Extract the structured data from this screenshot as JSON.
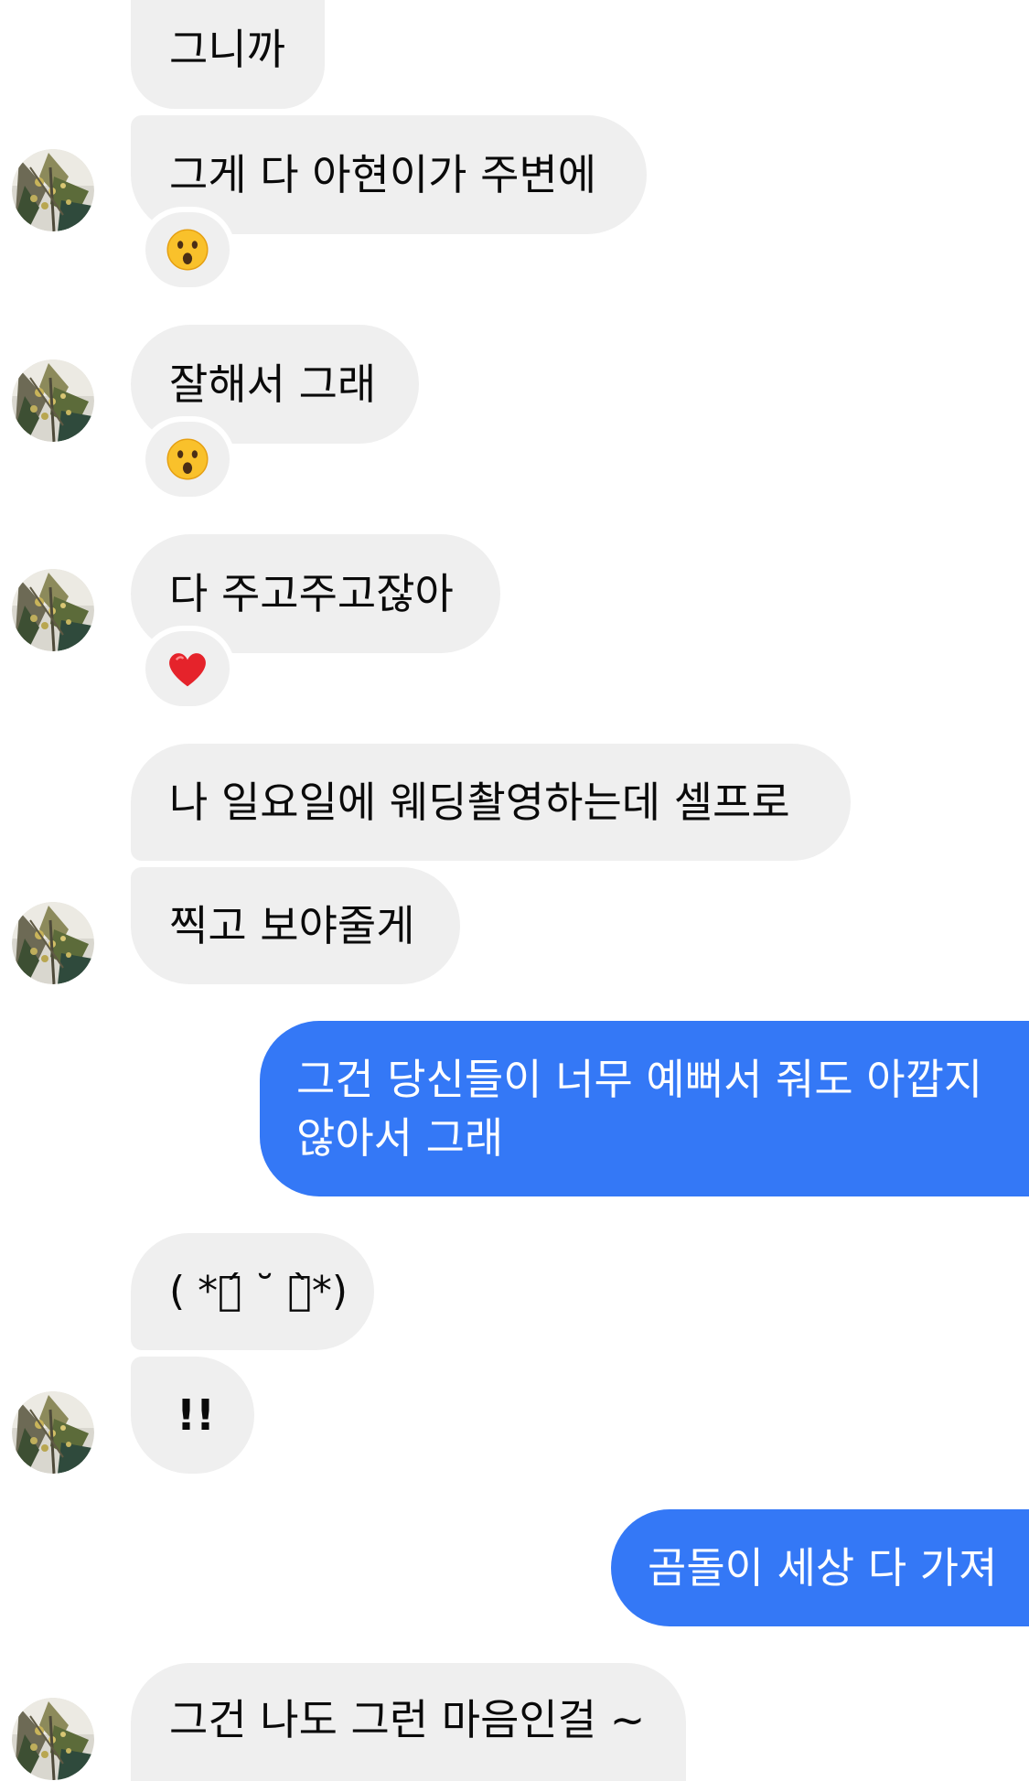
{
  "messages": {
    "m1": "그니까",
    "m2": "그게 다 아현이가 주변에",
    "m3": "잘해서 그래",
    "m4": "다 주고주고잖아",
    "m5": "나 일요일에 웨딩촬영하는데 셀프로",
    "m6": "찍고 보야줄게",
    "m7": "그건 당신들이 너무 예뻐서 줘도 아깝지 않아서 그래",
    "m8": "( *ก́ ˘ ก̀*)",
    "m9": "!!",
    "m10": "곰돌이 세상 다 가져",
    "m11": "그건 나도 그런 마음인걸 ~"
  },
  "reactions": {
    "r1": "astonished-face",
    "r2": "astonished-face",
    "r3": "red-heart"
  },
  "colors": {
    "incoming_bubble": "#efefef",
    "outgoing_bubble": "#3478f6",
    "background": "#ffffff"
  }
}
